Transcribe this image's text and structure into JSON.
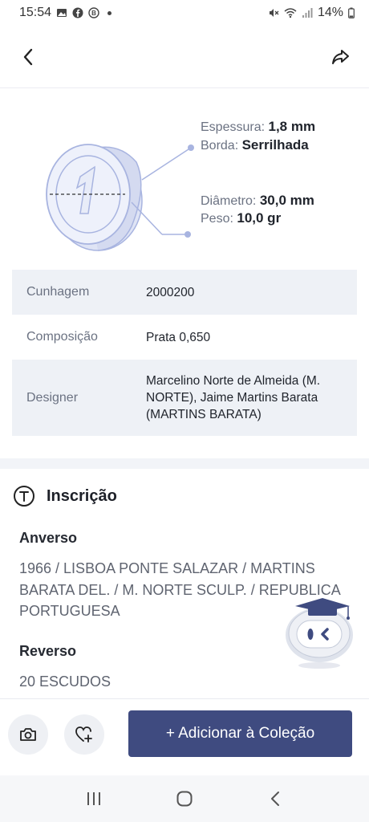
{
  "status": {
    "time": "15:54",
    "battery": "14%"
  },
  "specs": {
    "thickness_label": "Espessura:",
    "thickness_value": "1,8 mm",
    "edge_label": "Borda:",
    "edge_value": "Serrilhada",
    "diameter_label": "Diâmetro:",
    "diameter_value": "30,0 mm",
    "weight_label": "Peso:",
    "weight_value": "10,0 gr"
  },
  "details": {
    "rows": [
      {
        "key": "Cunhagem",
        "value": "2000200"
      },
      {
        "key": "Composição",
        "value": "Prata 0,650"
      },
      {
        "key": "Designer",
        "value": "Marcelino Norte de Almeida (M. NORTE), Jaime Martins Barata (MARTINS BARATA)"
      }
    ]
  },
  "inscription": {
    "title": "Inscrição",
    "obverse_label": "Anverso",
    "obverse_text": "1966 / LISBOA PONTE SALAZAR / MARTINS BARATA DEL. / M. NORTE SCULP. / REPUBLICA PORTUGUESA",
    "reverse_label": "Reverso",
    "reverse_text": "20 ESCUDOS"
  },
  "actions": {
    "add_label": "+ Adicionar à Coleção"
  },
  "colors": {
    "primary": "#3f4b80",
    "alt_row": "#eef1f6",
    "coin": "#a8b4e0"
  }
}
